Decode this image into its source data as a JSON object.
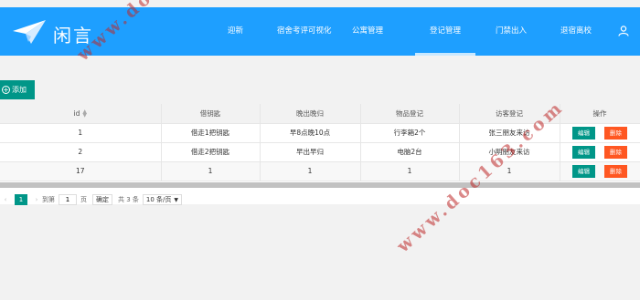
{
  "brand": {
    "name": "闲言"
  },
  "nav": {
    "items": [
      "迎新",
      "宿舍考评可视化",
      "公寓管理",
      "登记管理",
      "门禁出入",
      "退宿离校"
    ],
    "active": "登记管理"
  },
  "toolbar": {
    "add_label": "添加"
  },
  "table": {
    "headers": [
      "id",
      "借钥匙",
      "晚出晚归",
      "物品登记",
      "访客登记",
      "操作"
    ],
    "rows": [
      [
        "1",
        "借走1把钥匙",
        "早8点晚10点",
        "行李箱2个",
        "张三朋友来访"
      ],
      [
        "2",
        "借走2把钥匙",
        "早出早归",
        "电脑2台",
        "小明朋友来访"
      ],
      [
        "17",
        "1",
        "1",
        "1",
        "1"
      ]
    ],
    "edit_label": "编辑",
    "delete_label": "删除"
  },
  "pager": {
    "current": "1",
    "goto_label": "到第",
    "goto_value": "1",
    "page_unit": "页",
    "confirm_label": "确定",
    "total": "共 3 条",
    "page_size": "10 条/页"
  },
  "watermark": "www.doc163.com",
  "colors": {
    "header": "#1e9fff",
    "primary": "#009688",
    "danger": "#ff5722"
  }
}
